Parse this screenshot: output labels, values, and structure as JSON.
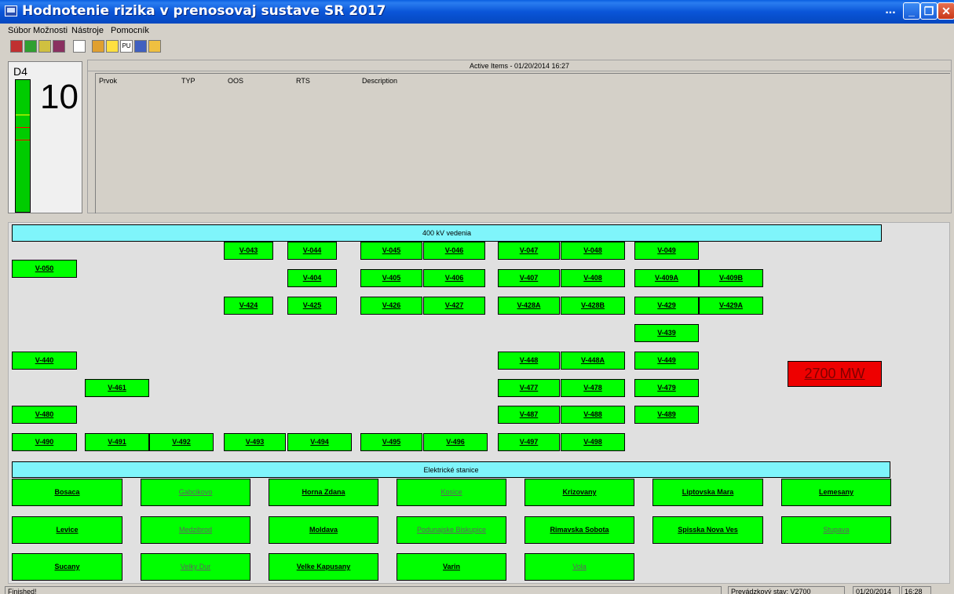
{
  "window": {
    "title": "Hodnotenie rizika v prenosovaj sustave SR 2017",
    "ellipsis": "...",
    "buttons": {
      "minimize": "_",
      "maximize": "❐",
      "close": "✕"
    }
  },
  "menu": [
    "Súbor",
    "Možnosti",
    "Nástroje",
    "Pomocník"
  ],
  "toolbar": {
    "pu_label": "PU",
    "icons": [
      "tool-1-icon",
      "tool-2-icon",
      "tool-3-icon",
      "tool-4-icon",
      "tool-5-icon",
      "tool-6-icon",
      "tool-7-icon",
      "pu-icon",
      "tool-9-icon",
      "tool-10-icon"
    ]
  },
  "indicator": {
    "label": "D4",
    "value": "10"
  },
  "active_items": {
    "heading": "Active Items - 01/20/2014 16:27",
    "columns": [
      "Prvok",
      "TYP",
      "OOS",
      "RTS",
      "Description"
    ]
  },
  "lines_section": {
    "header": "400 kV vedenia",
    "rows": [
      [
        "V-043",
        "V-044",
        "V-045",
        "V-046",
        "V-047",
        "V-048",
        "V-049"
      ],
      [
        "V-050"
      ],
      [
        "V-404",
        "V-405",
        "V-406",
        "V-407",
        "V-408",
        "V-409A",
        "V-409B"
      ],
      [
        "V-424",
        "V-425",
        "V-426",
        "V-427",
        "V-428A",
        "V-428B",
        "V-429",
        "V-429A"
      ],
      [
        "V-439"
      ],
      [
        "V-440",
        "V-448",
        "V-448A",
        "V-449"
      ],
      [
        "V-461",
        "V-477",
        "V-478",
        "V-479"
      ],
      [
        "V-480",
        "V-487",
        "V-488",
        "V-489"
      ],
      [
        "V-490",
        "V-491",
        "V-492",
        "V-493",
        "V-494",
        "V-495",
        "V-496",
        "V-497",
        "V-498"
      ]
    ]
  },
  "power": {
    "text": "2700 MW",
    "color": "#ee0000"
  },
  "stations_section": {
    "header": "Elektrické stanice",
    "stations": [
      "Bosaca",
      "Gabcikovo",
      "Horna Zdana",
      "Kosice",
      "Krizovany",
      "Liptovska Mara",
      "Lemesany",
      "Levice",
      "Medzibrod",
      "Moldava",
      "Podunajske Biskupice",
      "Rimavska Sobota",
      "Spisska Nova Ves",
      "Stupava",
      "Sucany",
      "Velky Dur",
      "Velke Kapusany",
      "Varin",
      "Vola"
    ],
    "dimmed": [
      "Gabcikovo",
      "Kosice",
      "Medzibrod",
      "Podunajske Biskupice",
      "Stupava",
      "Velky Dur",
      "Vola"
    ]
  },
  "status": {
    "left": "Finished!",
    "state": "Prevádzkový stav: V2700",
    "date": "01/20/2014",
    "time": "16:28"
  },
  "colors": {
    "line_ok": "#00ff00",
    "header_bg": "#7ff5fb",
    "gauge": "#00cc00"
  }
}
